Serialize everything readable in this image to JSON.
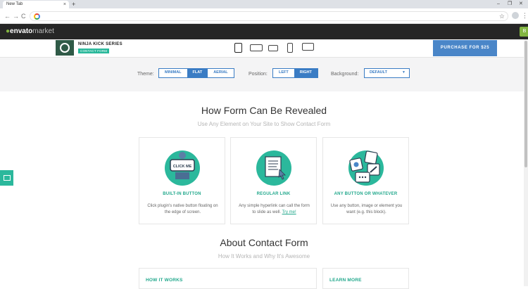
{
  "browser": {
    "tab_title": "New Tab",
    "tab_close": "×",
    "new_tab": "+",
    "window_controls": [
      "–",
      "❐",
      "✕"
    ],
    "back": "←",
    "forward": "→",
    "reload": "C",
    "star": "☆",
    "menu": "⋮"
  },
  "envato": {
    "leaf": "●",
    "brand": "envato",
    "market": "market",
    "cta": "B"
  },
  "product": {
    "title": "NINJA KICK SERIES",
    "badge": "CONTACT FORM",
    "purchase_label": "PURCHASE FOR $25"
  },
  "options": {
    "theme_label": "Theme:",
    "theme_options": [
      "MINIMAL",
      "FLAT",
      "AERIAL"
    ],
    "theme_selected": "FLAT",
    "position_label": "Position:",
    "position_options": [
      "LEFT",
      "RIGHT"
    ],
    "position_selected": "RIGHT",
    "background_label": "Background:",
    "background_value": "DEFAULT",
    "caret": "▼"
  },
  "section1": {
    "title": "How Form Can Be Revealed",
    "subtitle": "Use Any Element on Your Site to Show Contact Form"
  },
  "cards": [
    {
      "label": "BUILT-IN BUTTON",
      "desc": "Click plugin's native button floating on the edge of screen.",
      "icon_text": "CLICK ME"
    },
    {
      "label": "REGULAR LINK",
      "desc": "Any simple hyperlink can call the form to slide as well.",
      "link": "Try me!"
    },
    {
      "label": "ANY BUTTON OR WHATEVER",
      "desc": "Use any button, image or element you want (e.g. this block)."
    }
  ],
  "section2": {
    "title": "About Contact Form",
    "subtitle": "How It Works and Why It's Awesome"
  },
  "bottom_cards": [
    {
      "label": "HOW IT WORKS"
    },
    {
      "label": "LEARN MORE"
    }
  ]
}
